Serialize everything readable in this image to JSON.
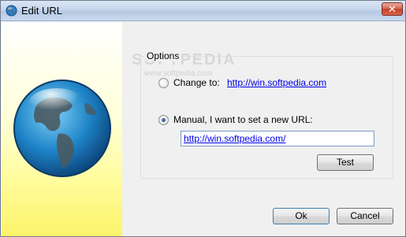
{
  "window": {
    "title": "Edit URL",
    "close_label": "✕"
  },
  "watermark": {
    "brand": "SOFTPEDIA",
    "url": "www.softpedia.com"
  },
  "options": {
    "group_label": "Options",
    "change_to_label": "Change to:",
    "change_to_url": "http://win.softpedia.com",
    "change_to_checked": false,
    "manual_label": "Manual, I want to set a new URL:",
    "manual_checked": true,
    "url_value": "http://win.softpedia.com/",
    "test_label": "Test"
  },
  "buttons": {
    "ok_label": "Ok",
    "cancel_label": "Cancel"
  },
  "colors": {
    "link": "#0000ee",
    "sidebar_gradient_end": "#fbf36a",
    "close_button": "#c4412a"
  },
  "icons": {
    "title": "globe-icon",
    "sidebar": "globe-illustration"
  }
}
